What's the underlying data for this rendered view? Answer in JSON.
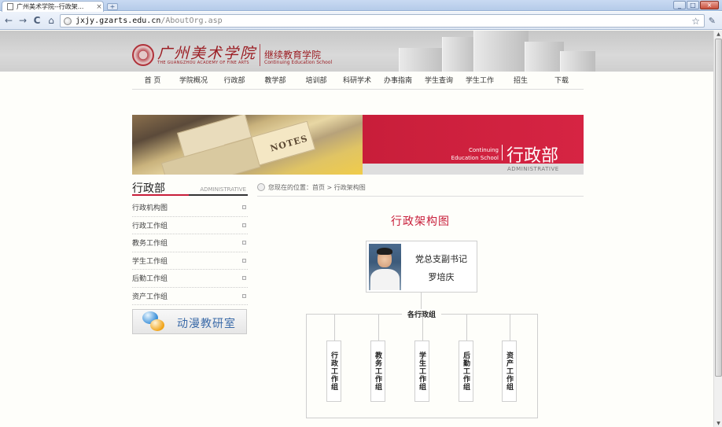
{
  "browser": {
    "tab_title": "广州美术学院--行政架...",
    "tab_close": "×",
    "new_tab": "+",
    "url_host": "jxjy.gzarts.edu.cn",
    "url_path": "/AboutOrg.asp",
    "back": "←",
    "forward": "→",
    "reload": "C",
    "home": "⌂",
    "star": "☆",
    "wrench": "✎",
    "win_min": "_",
    "win_max": "□",
    "win_close": "×"
  },
  "header": {
    "logo_cn": "广州美术学院",
    "logo_en": "THE GUANGZHOU ACADEMY OF FINE ARTS",
    "school_cn": "继续教育学院",
    "school_en": "Continuing Education School"
  },
  "nav": [
    "首 页",
    "学院概况",
    "行政部",
    "教学部",
    "培训部",
    "科研学术",
    "办事指南",
    "学生查询",
    "学生工作",
    "招生",
    "下载"
  ],
  "banner": {
    "notes": "NOTES",
    "en_line1": "Continuing",
    "en_line2": "Education School",
    "cn": "行政部",
    "sub": "ADMINISTRATIVE"
  },
  "sidebar": {
    "title_cn": "行政部",
    "title_en": "ADMINISTRATIVE",
    "items": [
      "行政机构图",
      "行政工作组",
      "教务工作组",
      "学生工作组",
      "后勤工作组",
      "资产工作组"
    ],
    "anim_button": "动漫教研室"
  },
  "breadcrumb": {
    "prefix": "您现在的位置：",
    "home": "首页",
    "sep": " > ",
    "current": "行政架构图"
  },
  "content": {
    "title": "行政架构图",
    "leader_title": "党总支副书记",
    "leader_name": "罗培庆",
    "group_label": "各行政组",
    "groups": [
      "行政工作组",
      "教务工作组",
      "学生工作组",
      "后勤工作组",
      "资产工作组"
    ]
  },
  "colors": {
    "accent_red": "#c81e3a",
    "logo_red": "#9b1d23"
  }
}
